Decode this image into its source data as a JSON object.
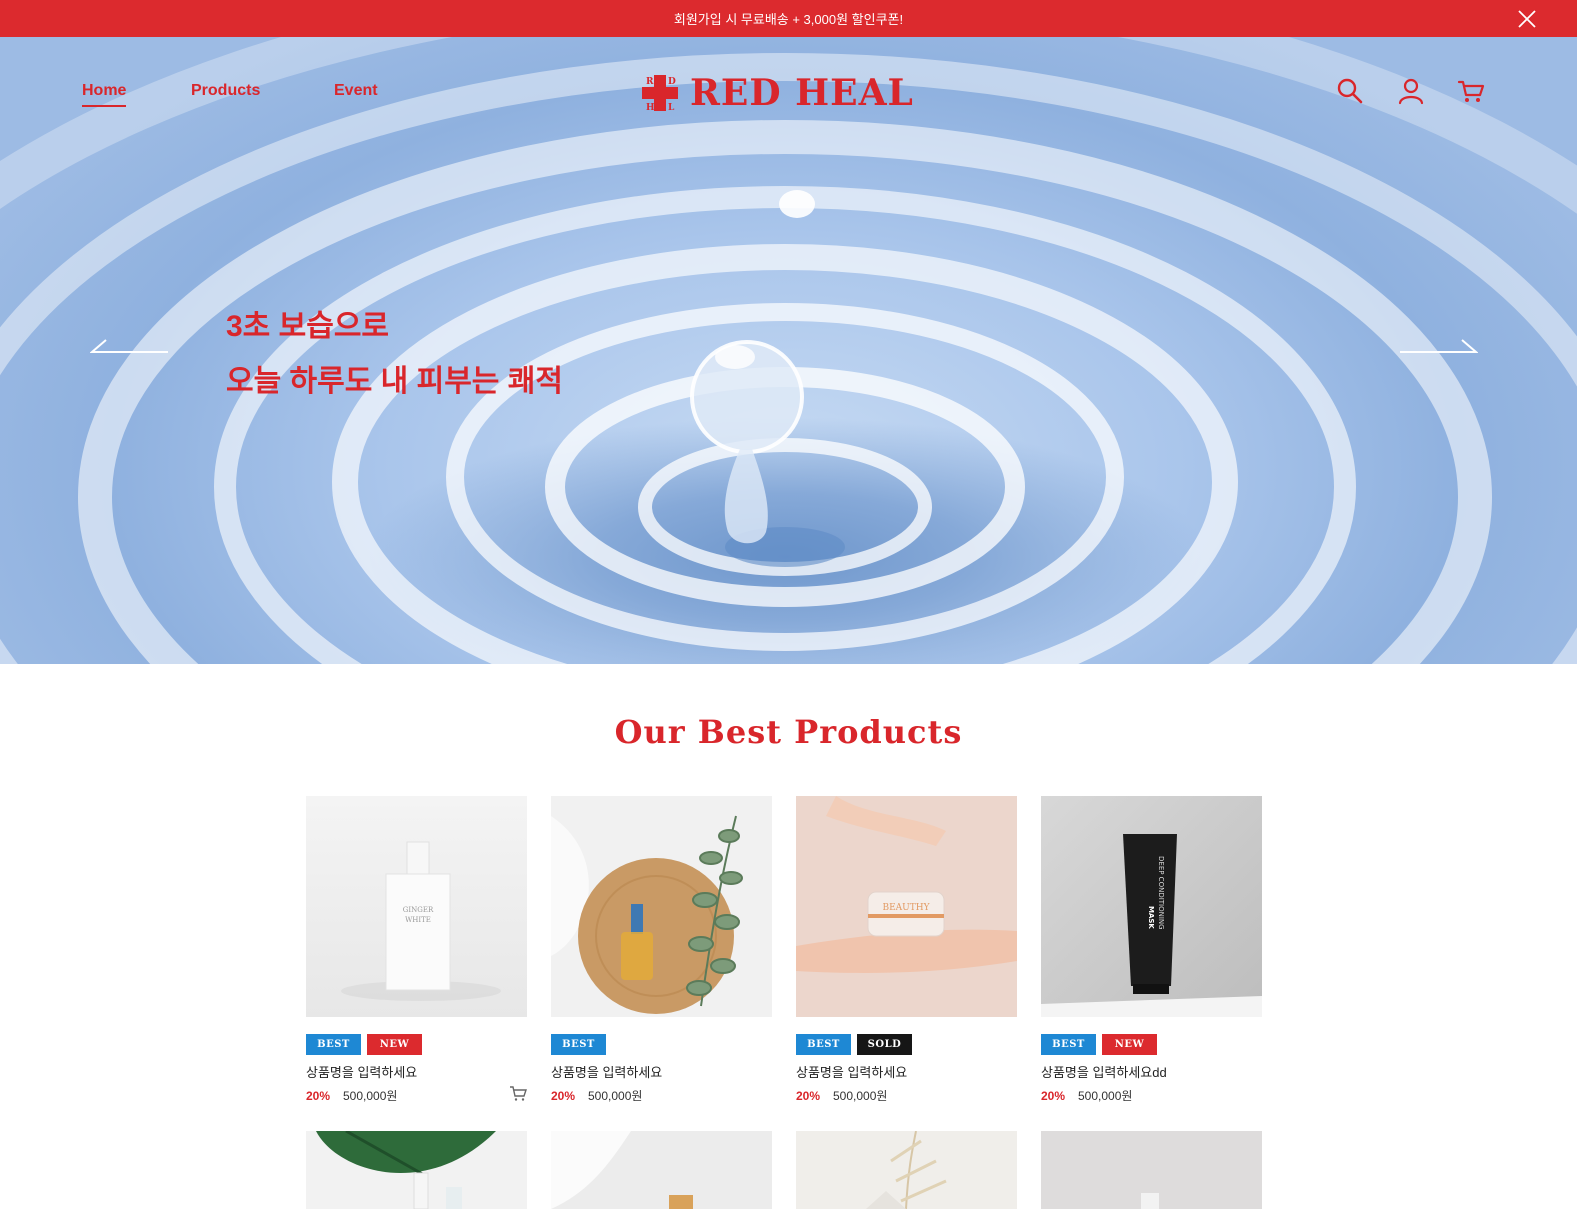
{
  "announcement": {
    "text": "회원가입 시 무료배송 + 3,000원 할인쿠폰!",
    "close_icon": "close-icon"
  },
  "nav": {
    "home": "Home",
    "products": "Products",
    "event": "Event"
  },
  "brand": {
    "name": "RED HEAL",
    "mark_letters": [
      "R",
      "D",
      "H",
      "L"
    ]
  },
  "header_icons": [
    "search-icon",
    "user-icon",
    "cart-icon"
  ],
  "hero": {
    "line1": "3초 보습으로",
    "line2": "오늘 하루도 내 피부는 쾌적"
  },
  "best": {
    "title": "Our Best Products",
    "products": [
      {
        "badges": [
          "BEST",
          "NEW"
        ],
        "name": "상품명을 입력하세요",
        "discount": "20%",
        "price": "500,000원",
        "has_cart": true,
        "label": [
          "GINGER",
          "WHITE"
        ]
      },
      {
        "badges": [
          "BEST"
        ],
        "name": "상품명을 입력하세요",
        "discount": "20%",
        "price": "500,000원",
        "has_cart": false
      },
      {
        "badges": [
          "BEST",
          "SOLD"
        ],
        "name": "상품명을 입력하세요",
        "discount": "20%",
        "price": "500,000원",
        "has_cart": false,
        "label": [
          "BEAUTHY"
        ]
      },
      {
        "badges": [
          "BEST",
          "NEW"
        ],
        "name": "상품명을 입력하세요dd",
        "discount": "20%",
        "price": "500,000원",
        "has_cart": false,
        "label": [
          "DEEP CONDITIONING",
          "MASK"
        ]
      }
    ]
  },
  "colors": {
    "brand_red": "#dc2a2e",
    "best_blue": "#1e88d4",
    "sold_black": "#161616"
  }
}
